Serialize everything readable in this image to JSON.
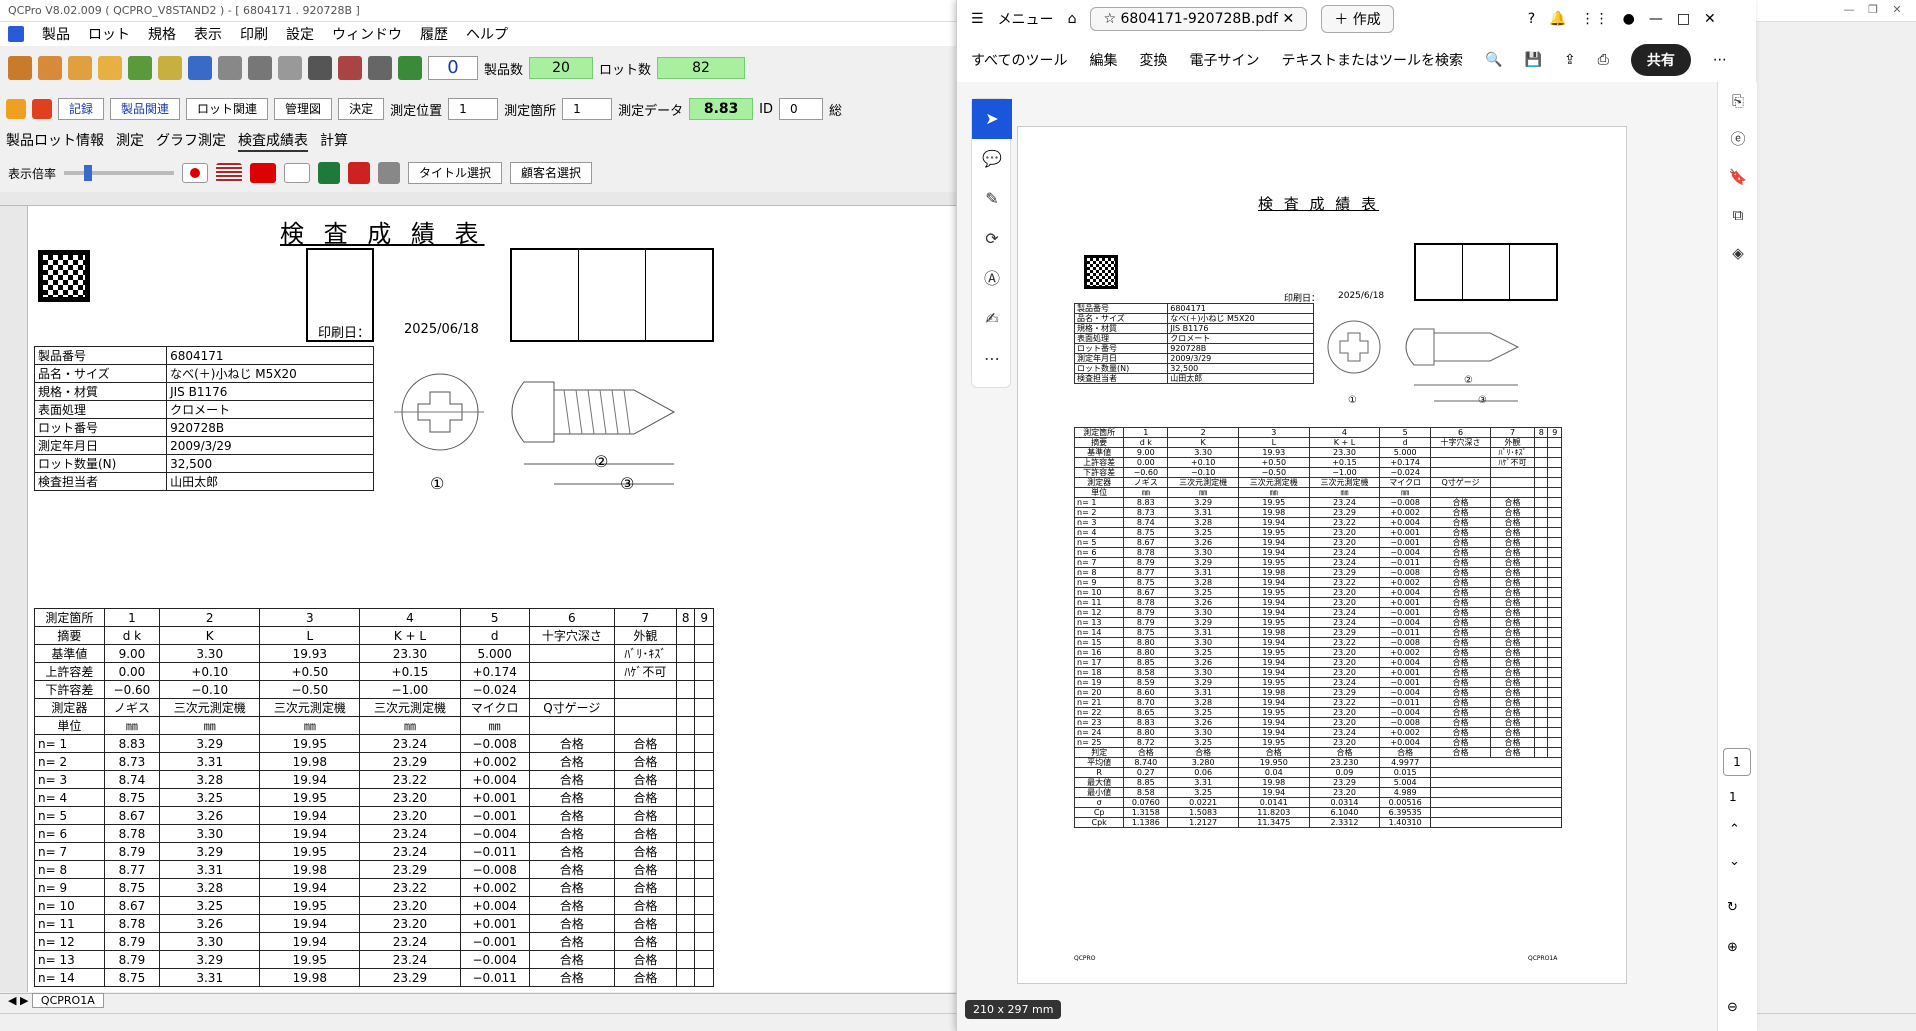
{
  "qc": {
    "title": "QCPro V8.02.009 ( QCPRO_V8STAND2 ) - [ 6804171 . 920728B ]",
    "menu": [
      "製品",
      "ロット",
      "規格",
      "表示",
      "印刷",
      "設定",
      "ウィンドウ",
      "履歴",
      "ヘルプ"
    ],
    "toolbar": {
      "count": "0",
      "products_label": "製品数",
      "products_value": "20",
      "lots_label": "ロット数",
      "lots_value": "82"
    },
    "toolbar2": {
      "buttons": [
        "記録",
        "製品関連",
        "ロット関連",
        "管理図",
        "決定"
      ],
      "pos_label": "測定位置",
      "pos_value": "1",
      "loc_label": "測定箇所",
      "loc_value": "1",
      "data_label": "測定データ",
      "data_value": "8.83",
      "id_label": "ID",
      "id_value": "0",
      "extra": "総"
    },
    "tabs": [
      "製品ロット情報",
      "測定",
      "グラフ測定",
      "検査成績表",
      "計算"
    ],
    "toolbar3": {
      "zoom_label": "表示倍率",
      "title_btn": "タイトル選択",
      "customer_btn": "顧客名選択"
    },
    "sheet_tab": "QCPRO1A",
    "doc": {
      "title": "検 査 成 績 表",
      "print_label": "印刷日：",
      "print_date": "2025/06/18",
      "info": [
        [
          "製品番号",
          "6804171"
        ],
        [
          "品名・サイズ",
          "なべ(＋)小ねじ M5X20"
        ],
        [
          "規格・材質",
          "JIS B1176"
        ],
        [
          "表面処理",
          "クロメート"
        ],
        [
          "ロット番号",
          "920728B"
        ],
        [
          "測定年月日",
          "2009/3/29"
        ],
        [
          "ロット数量(N)",
          "32,500"
        ],
        [
          "検査担当者",
          "山田太郎"
        ]
      ],
      "diagram_labels": [
        "①",
        "②",
        "③"
      ],
      "header_row": [
        "測定箇所",
        "1",
        "2",
        "3",
        "4",
        "5",
        "6",
        "7",
        "8",
        "9"
      ],
      "spec_rows": [
        [
          "摘要",
          "d k",
          "K",
          "L",
          "K + L",
          "d",
          "十字穴深さ",
          "外観",
          "",
          ""
        ],
        [
          "基準値",
          "9.00",
          "3.30",
          "19.93",
          "23.30",
          "5.000",
          "",
          "ﾊﾞﾘ･ｷｽﾞ",
          "",
          ""
        ],
        [
          "上許容差",
          "0.00",
          "+0.10",
          "+0.50",
          "+0.15",
          "+0.174",
          "",
          "ﾊｹﾞ不可",
          "",
          ""
        ],
        [
          "下許容差",
          "−0.60",
          "−0.10",
          "−0.50",
          "−1.00",
          "−0.024",
          "",
          "",
          "",
          ""
        ],
        [
          "測定器",
          "ノギス",
          "三次元測定機",
          "三次元測定機",
          "三次元測定機",
          "マイクロ",
          "Q寸ゲージ",
          "",
          "",
          ""
        ],
        [
          "単位",
          "㎜",
          "㎜",
          "㎜",
          "㎜",
          "㎜",
          "",
          "",
          "",
          ""
        ]
      ],
      "measure_rows": [
        [
          "n=  1",
          "8.83",
          "3.29",
          "19.95",
          "23.24",
          "−0.008",
          "合格",
          "合格"
        ],
        [
          "n=  2",
          "8.73",
          "3.31",
          "19.98",
          "23.29",
          "+0.002",
          "合格",
          "合格"
        ],
        [
          "n=  3",
          "8.74",
          "3.28",
          "19.94",
          "23.22",
          "+0.004",
          "合格",
          "合格"
        ],
        [
          "n=  4",
          "8.75",
          "3.25",
          "19.95",
          "23.20",
          "+0.001",
          "合格",
          "合格"
        ],
        [
          "n=  5",
          "8.67",
          "3.26",
          "19.94",
          "23.20",
          "−0.001",
          "合格",
          "合格"
        ],
        [
          "n=  6",
          "8.78",
          "3.30",
          "19.94",
          "23.24",
          "−0.004",
          "合格",
          "合格"
        ],
        [
          "n=  7",
          "8.79",
          "3.29",
          "19.95",
          "23.24",
          "−0.011",
          "合格",
          "合格"
        ],
        [
          "n=  8",
          "8.77",
          "3.31",
          "19.98",
          "23.29",
          "−0.008",
          "合格",
          "合格"
        ],
        [
          "n=  9",
          "8.75",
          "3.28",
          "19.94",
          "23.22",
          "+0.002",
          "合格",
          "合格"
        ],
        [
          "n= 10",
          "8.67",
          "3.25",
          "19.95",
          "23.20",
          "+0.004",
          "合格",
          "合格"
        ],
        [
          "n= 11",
          "8.78",
          "3.26",
          "19.94",
          "23.20",
          "+0.001",
          "合格",
          "合格"
        ],
        [
          "n= 12",
          "8.79",
          "3.30",
          "19.94",
          "23.24",
          "−0.001",
          "合格",
          "合格"
        ],
        [
          "n= 13",
          "8.79",
          "3.29",
          "19.95",
          "23.24",
          "−0.004",
          "合格",
          "合格"
        ],
        [
          "n= 14",
          "8.75",
          "3.31",
          "19.98",
          "23.29",
          "−0.011",
          "合格",
          "合格"
        ]
      ]
    }
  },
  "pdf": {
    "tab_title": "6804171-920728B.pdf",
    "menu_label": "メニュー",
    "new_tab": "作成",
    "tools": [
      "すべてのツール",
      "編集",
      "変換",
      "電子サイン",
      "テキストまたはツールを検索"
    ],
    "share": "共有",
    "page_num": "1",
    "page_total": "1",
    "size_badge": "210 x 297 mm",
    "doc": {
      "title": "検 査 成 績 表",
      "print_label": "印刷日：",
      "print_date": "2025/6/18",
      "info": [
        [
          "製品番号",
          "6804171"
        ],
        [
          "品名・サイズ",
          "なべ(＋)小ねじ M5X20"
        ],
        [
          "規格・材質",
          "JIS B1176"
        ],
        [
          "表面処理",
          "クロメート"
        ],
        [
          "ロット番号",
          "920728B"
        ],
        [
          "測定年月日",
          "2009/3/29"
        ],
        [
          "ロット数量(N)",
          "32,500"
        ],
        [
          "検査担当者",
          "山田太郎"
        ]
      ],
      "header_row": [
        "測定箇所",
        "1",
        "2",
        "3",
        "4",
        "5",
        "6",
        "7",
        "8",
        "9"
      ],
      "spec_rows": [
        [
          "摘要",
          "d k",
          "K",
          "L",
          "K + L",
          "d",
          "十字穴深さ",
          "外観",
          "",
          ""
        ],
        [
          "基準値",
          "9.00",
          "3.30",
          "19.93",
          "23.30",
          "5.000",
          "",
          "ﾊﾞﾘ･ｷｽﾞ",
          "",
          ""
        ],
        [
          "上許容差",
          "0.00",
          "+0.10",
          "+0.50",
          "+0.15",
          "+0.174",
          "",
          "ﾊｹﾞ不可",
          "",
          ""
        ],
        [
          "下許容差",
          "−0.60",
          "−0.10",
          "−0.50",
          "−1.00",
          "−0.024",
          "",
          "",
          "",
          ""
        ],
        [
          "測定器",
          "ノギス",
          "三次元測定機",
          "三次元測定機",
          "三次元測定機",
          "マイクロ",
          "Q寸ゲージ",
          "",
          "",
          ""
        ],
        [
          "単位",
          "㎜",
          "㎜",
          "㎜",
          "㎜",
          "㎜",
          "",
          "",
          "",
          ""
        ]
      ],
      "measure_rows": [
        [
          "n=  1",
          "8.83",
          "3.29",
          "19.95",
          "23.24",
          "−0.008",
          "合格",
          "合格"
        ],
        [
          "n=  2",
          "8.73",
          "3.31",
          "19.98",
          "23.29",
          "+0.002",
          "合格",
          "合格"
        ],
        [
          "n=  3",
          "8.74",
          "3.28",
          "19.94",
          "23.22",
          "+0.004",
          "合格",
          "合格"
        ],
        [
          "n=  4",
          "8.75",
          "3.25",
          "19.95",
          "23.20",
          "+0.001",
          "合格",
          "合格"
        ],
        [
          "n=  5",
          "8.67",
          "3.26",
          "19.94",
          "23.20",
          "−0.001",
          "合格",
          "合格"
        ],
        [
          "n=  6",
          "8.78",
          "3.30",
          "19.94",
          "23.24",
          "−0.004",
          "合格",
          "合格"
        ],
        [
          "n=  7",
          "8.79",
          "3.29",
          "19.95",
          "23.24",
          "−0.011",
          "合格",
          "合格"
        ],
        [
          "n=  8",
          "8.77",
          "3.31",
          "19.98",
          "23.29",
          "−0.008",
          "合格",
          "合格"
        ],
        [
          "n=  9",
          "8.75",
          "3.28",
          "19.94",
          "23.22",
          "+0.002",
          "合格",
          "合格"
        ],
        [
          "n= 10",
          "8.67",
          "3.25",
          "19.95",
          "23.20",
          "+0.004",
          "合格",
          "合格"
        ],
        [
          "n= 11",
          "8.78",
          "3.26",
          "19.94",
          "23.20",
          "+0.001",
          "合格",
          "合格"
        ],
        [
          "n= 12",
          "8.79",
          "3.30",
          "19.94",
          "23.24",
          "−0.001",
          "合格",
          "合格"
        ],
        [
          "n= 13",
          "8.79",
          "3.29",
          "19.95",
          "23.24",
          "−0.004",
          "合格",
          "合格"
        ],
        [
          "n= 14",
          "8.75",
          "3.31",
          "19.98",
          "23.29",
          "−0.011",
          "合格",
          "合格"
        ],
        [
          "n= 15",
          "8.80",
          "3.30",
          "19.94",
          "23.22",
          "−0.008",
          "合格",
          "合格"
        ],
        [
          "n= 16",
          "8.80",
          "3.25",
          "19.95",
          "23.20",
          "+0.002",
          "合格",
          "合格"
        ],
        [
          "n= 17",
          "8.85",
          "3.26",
          "19.94",
          "23.20",
          "+0.004",
          "合格",
          "合格"
        ],
        [
          "n= 18",
          "8.58",
          "3.30",
          "19.94",
          "23.20",
          "+0.001",
          "合格",
          "合格"
        ],
        [
          "n= 19",
          "8.59",
          "3.29",
          "19.95",
          "23.24",
          "−0.001",
          "合格",
          "合格"
        ],
        [
          "n= 20",
          "8.60",
          "3.31",
          "19.98",
          "23.29",
          "−0.004",
          "合格",
          "合格"
        ],
        [
          "n= 21",
          "8.70",
          "3.28",
          "19.94",
          "23.22",
          "−0.011",
          "合格",
          "合格"
        ],
        [
          "n= 22",
          "8.65",
          "3.25",
          "19.95",
          "23.20",
          "−0.004",
          "合格",
          "合格"
        ],
        [
          "n= 23",
          "8.83",
          "3.26",
          "19.94",
          "23.20",
          "−0.008",
          "合格",
          "合格"
        ],
        [
          "n= 24",
          "8.80",
          "3.30",
          "19.94",
          "23.24",
          "+0.002",
          "合格",
          "合格"
        ],
        [
          "n= 25",
          "8.72",
          "3.25",
          "19.95",
          "23.20",
          "+0.004",
          "合格",
          "合格"
        ]
      ],
      "judge_row": [
        "判定",
        "合格",
        "合格",
        "合格",
        "合格",
        "合格",
        "合格",
        "合格"
      ],
      "stat_rows": [
        [
          "平均値",
          "8.740",
          "3.280",
          "19.950",
          "23.230",
          "4.9977"
        ],
        [
          "R",
          "0.27",
          "0.06",
          "0.04",
          "0.09",
          "0.015"
        ],
        [
          "最大値",
          "8.85",
          "3.31",
          "19.98",
          "23.29",
          "5.004"
        ],
        [
          "最小値",
          "8.58",
          "3.25",
          "19.94",
          "23.20",
          "4.989"
        ],
        [
          "σ",
          "0.0760",
          "0.0221",
          "0.0141",
          "0.0314",
          "0.00516"
        ],
        [
          "Cp",
          "1.3158",
          "1.5083",
          "11.8203",
          "6.1040",
          "6.39535"
        ],
        [
          "Cpk",
          "1.1386",
          "1.2127",
          "11.3475",
          "2.3312",
          "1.40310"
        ]
      ],
      "footer_left": "QCPRO",
      "footer_right": "QCPRO1A"
    }
  }
}
